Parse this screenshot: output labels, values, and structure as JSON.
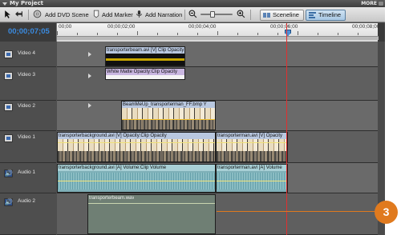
{
  "window": {
    "title": "My Project",
    "more_label": "MORE"
  },
  "toolbar": {
    "add_dvd_scene": "Add DVD Scene",
    "add_marker": "Add Marker",
    "add_narration": "Add Narration",
    "sceneline": "Sceneline",
    "timeline": "Timeline"
  },
  "timecode": "00;00;07;05",
  "ruler": {
    "labels": [
      "00;00",
      "00;00;02;00",
      "00;00;04;00",
      "00;00;06;00",
      "00;00;08;00"
    ]
  },
  "tracks": {
    "video4": {
      "name": "Video 4",
      "clip_label": "transporterbeam.avi [V] Clip Opacity"
    },
    "video3": {
      "name": "Video 3",
      "clip_label": "White Matte Opacity:Clip Opacity"
    },
    "video2": {
      "name": "Video 2",
      "clip_label": "BeamMeUp_transporterman_FF.bmp Y"
    },
    "video1": {
      "name": "Video 1",
      "clip_a": "transporterbackground.avi [V] Opacity:Clip Opacity",
      "clip_b": "transporterman.avi [V] Opacity"
    },
    "audio1": {
      "name": "Audio 1",
      "clip_a": "transporterbackground.avi [A] Volume:Clip Volume",
      "clip_b": "transporterman.avi [A] Volume"
    },
    "audio2": {
      "name": "Audio 2",
      "clip_label": "transporterbeam.wav"
    }
  },
  "callout": {
    "number": "3",
    "color": "#e07a1e"
  },
  "colors": {
    "playhead": "#e03030",
    "timecode": "#3a8be0"
  }
}
